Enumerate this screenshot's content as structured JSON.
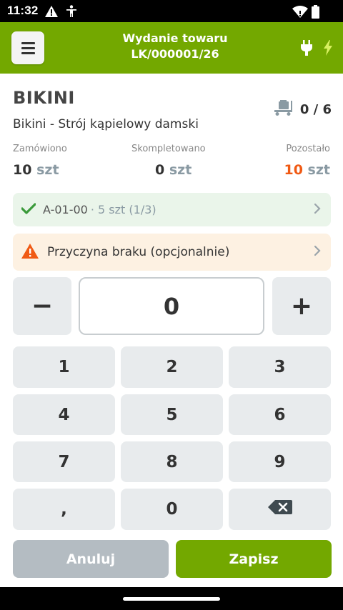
{
  "status_bar": {
    "time": "11:32",
    "icons": [
      "warning-icon",
      "accessibility-icon",
      "wifi-icon",
      "battery-icon"
    ]
  },
  "app_bar": {
    "title_line1": "Wydanie towaru",
    "title_line2": "LK/000001/26",
    "icons": [
      "menu-icon",
      "plug-icon",
      "bolt-icon"
    ]
  },
  "product": {
    "code": "BIKINI",
    "name": "Bikini - Strój kąpielowy damski",
    "progress": "0 / 6"
  },
  "stats": {
    "ordered_label": "Zamówiono",
    "ordered_value": "10",
    "completed_label": "Skompletowano",
    "completed_value": "0",
    "remaining_label": "Pozostało",
    "remaining_value": "10",
    "unit": "szt"
  },
  "location": {
    "code": "A-01-00",
    "detail": "· 5 szt (1/3)"
  },
  "reason": {
    "label": "Przyczyna braku (opcjonalnie)"
  },
  "quantity": {
    "value": "0",
    "minus": "−",
    "plus": "+"
  },
  "keypad": {
    "k1": "1",
    "k2": "2",
    "k3": "3",
    "k4": "4",
    "k5": "5",
    "k6": "6",
    "k7": "7",
    "k8": "8",
    "k9": "9",
    "comma": ",",
    "k0": "0"
  },
  "actions": {
    "cancel": "Anuluj",
    "save": "Zapisz"
  },
  "colors": {
    "brand_green": "#73a800",
    "remaining_orange": "#f05a14",
    "success_green": "#3a9a3a",
    "warning_orange": "#f05a14"
  }
}
